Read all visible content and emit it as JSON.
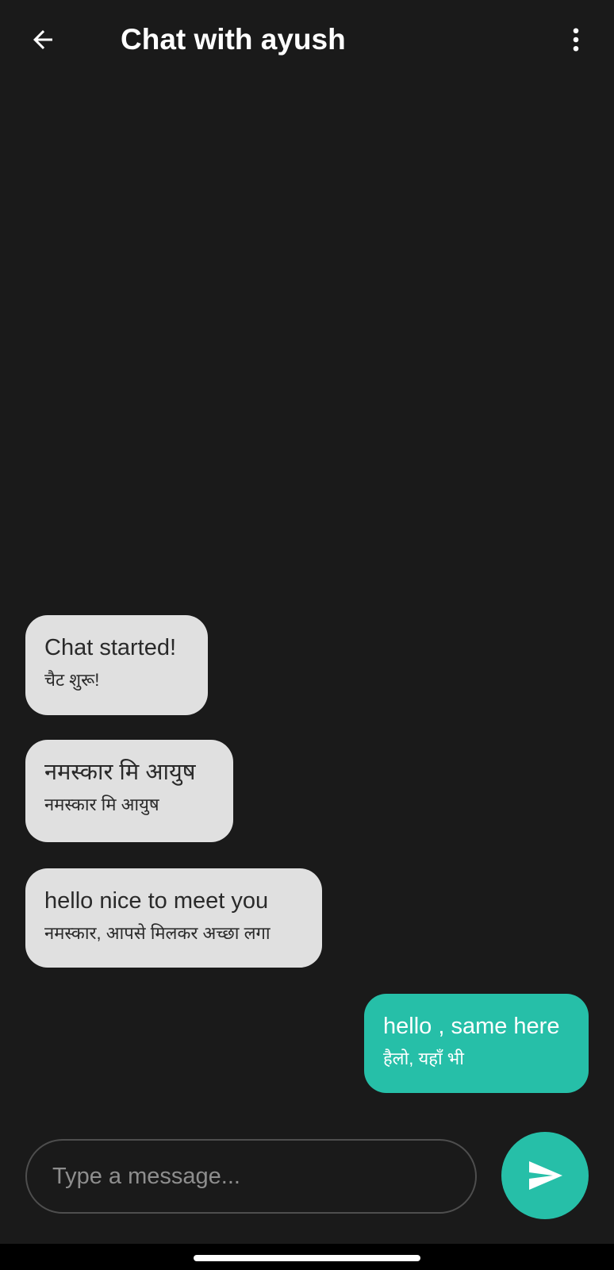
{
  "header": {
    "title": "Chat with ayush",
    "back_icon": "arrow-left-icon",
    "menu_icon": "more-vertical-icon"
  },
  "messages": [
    {
      "direction": "incoming",
      "text": "Chat started!",
      "translation": "चैट शुरू!"
    },
    {
      "direction": "incoming",
      "text": "नमस्कार मि आयुष",
      "translation": "नमस्कार मि आयुष"
    },
    {
      "direction": "incoming",
      "text": "hello nice to meet you",
      "translation": "नमस्कार, आपसे मिलकर अच्छा लगा"
    },
    {
      "direction": "outgoing",
      "text": "hello , same here",
      "translation": "हैलो, यहाँ भी"
    }
  ],
  "composer": {
    "placeholder": "Type a message...",
    "value": "",
    "send_icon": "send-icon"
  },
  "colors": {
    "background": "#1a1a1a",
    "incoming_bubble": "#e0e0e0",
    "outgoing_bubble": "#26bfa8",
    "accent": "#26bfa8"
  }
}
